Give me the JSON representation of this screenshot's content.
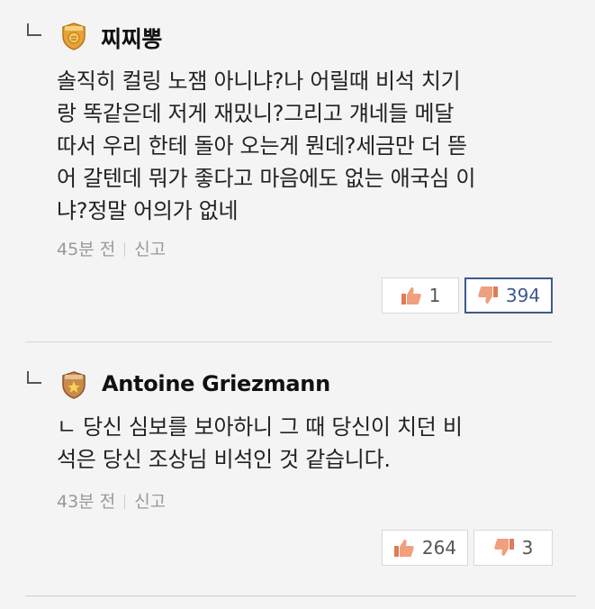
{
  "comments": [
    {
      "username": "찌찌뽕",
      "badge_icon": "gold-shield-badge-icon",
      "text": "솔직히 컬링 노잼 아니냐?나 어릴때 비석 치기\n랑 똑같은데 저게 재밌니?그리고 걔네들 메달\n따서 우리 한테 돌아 오는게 뭔데?세금만 더 뜯\n어 갈텐데 뭐가 좋다고 마음에도 없는 애국심 이\n냐?정말 어의가 없네",
      "time": "45분 전",
      "report_label": "신고",
      "likes": "1",
      "dislikes": "394"
    },
    {
      "username": "Antoine Griezmann",
      "badge_icon": "bronze-star-badge-icon",
      "text": "ㄴ 당신 심보를 보아하니 그 때 당신이 치던 비\n석은 당신 조상님 비석인 것 같습니다.",
      "time": "43분 전",
      "report_label": "신고",
      "likes": "264",
      "dislikes": "3"
    }
  ],
  "colors": {
    "background": "#f4f4f4",
    "dislike_active": "#3d5a8c",
    "thumb_up": "#e07b54",
    "thumb_down": "#e07b54"
  }
}
